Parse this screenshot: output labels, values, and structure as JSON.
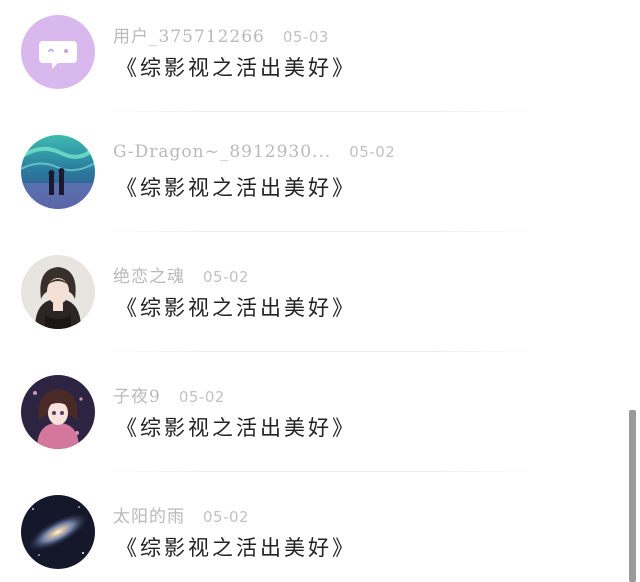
{
  "comments": [
    {
      "avatar": "chat-bubble-avatar-icon",
      "username": "用户_375712266",
      "date": "05-03",
      "text": "《综影视之活出美好》"
    },
    {
      "avatar": "aurora-couple-avatar",
      "username": "G-Dragon~_8912930...",
      "date": "05-02",
      "text": "《综影视之活出美好》"
    },
    {
      "avatar": "girl-portrait-avatar",
      "username": "绝恋之魂",
      "date": "05-02",
      "text": "《综影视之活出美好》"
    },
    {
      "avatar": "anime-girl-avatar",
      "username": "子夜9",
      "date": "05-02",
      "text": "《综影视之活出美好》"
    },
    {
      "avatar": "galaxy-avatar",
      "username": "太阳的雨",
      "date": "05-02",
      "text": "《综影视之活出美好》"
    }
  ],
  "colors": {
    "username": "#b9b9b9",
    "text": "#222222",
    "scrollbar": "#9a9a9a",
    "default_avatar_bg": "#d9b8ee"
  }
}
